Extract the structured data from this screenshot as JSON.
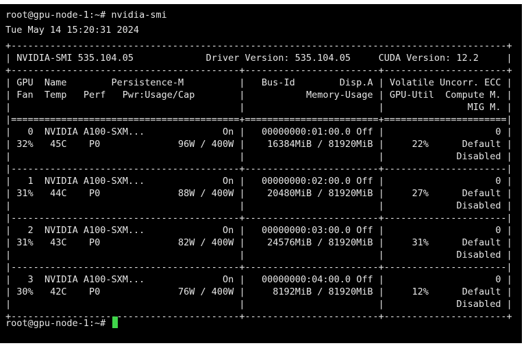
{
  "terminal": {
    "prompt1": "root@gpu-node-1:~# nvidia-smi",
    "date": "Tue May 14 15:20:31 2024",
    "prompt2": "root@gpu-node-1:~#",
    "cursor_color": "#3fd54a"
  },
  "smi": {
    "banner": {
      "name": "NVIDIA-SMI 535.104.05",
      "driver": "Driver Version: 535.104.05",
      "cuda": "CUDA Version: 12.2"
    },
    "header": {
      "row1": {
        "col1": "GPU  Name        Persistence-M",
        "col2": "Bus-Id        Disp.A",
        "col3": "Volatile Uncorr. ECC"
      },
      "row2": {
        "col1": "Fan  Temp   Perf   Pwr:Usage/Cap",
        "col2": "Memory-Usage",
        "col3": "GPU-Util  Compute M."
      },
      "row3": {
        "col3": "MIG M."
      }
    },
    "gpus": [
      {
        "id": "0",
        "name": "NVIDIA A100-SXM...",
        "persistence": "On",
        "bus_id": "00000000:01:00.0",
        "disp": "Off",
        "ecc": "0",
        "fan": "32%",
        "temp": "45C",
        "perf": "P0",
        "power": "96W / 400W",
        "memory": "16384MiB / 81920MiB",
        "util": "22%",
        "compute": "Default",
        "mig": "Disabled"
      },
      {
        "id": "1",
        "name": "NVIDIA A100-SXM...",
        "persistence": "On",
        "bus_id": "00000000:02:00.0",
        "disp": "Off",
        "ecc": "0",
        "fan": "31%",
        "temp": "44C",
        "perf": "P0",
        "power": "88W / 400W",
        "memory": "20480MiB / 81920MiB",
        "util": "27%",
        "compute": "Default",
        "mig": "Disabled"
      },
      {
        "id": "2",
        "name": "NVIDIA A100-SXM...",
        "persistence": "On",
        "bus_id": "00000000:03:00.0",
        "disp": "Off",
        "ecc": "0",
        "fan": "31%",
        "temp": "43C",
        "perf": "P0",
        "power": "82W / 400W",
        "memory": "24576MiB / 81920MiB",
        "util": "31%",
        "compute": "Default",
        "mig": "Disabled"
      },
      {
        "id": "3",
        "name": "NVIDIA A100-SXM...",
        "persistence": "On",
        "bus_id": "00000000:04:00.0",
        "disp": "Off",
        "ecc": "0",
        "fan": "30%",
        "temp": "42C",
        "perf": "P0",
        "power": "76W / 400W",
        "memory": "8192MiB / 81920MiB",
        "util": "12%",
        "compute": "Default",
        "mig": "Disabled"
      }
    ]
  }
}
